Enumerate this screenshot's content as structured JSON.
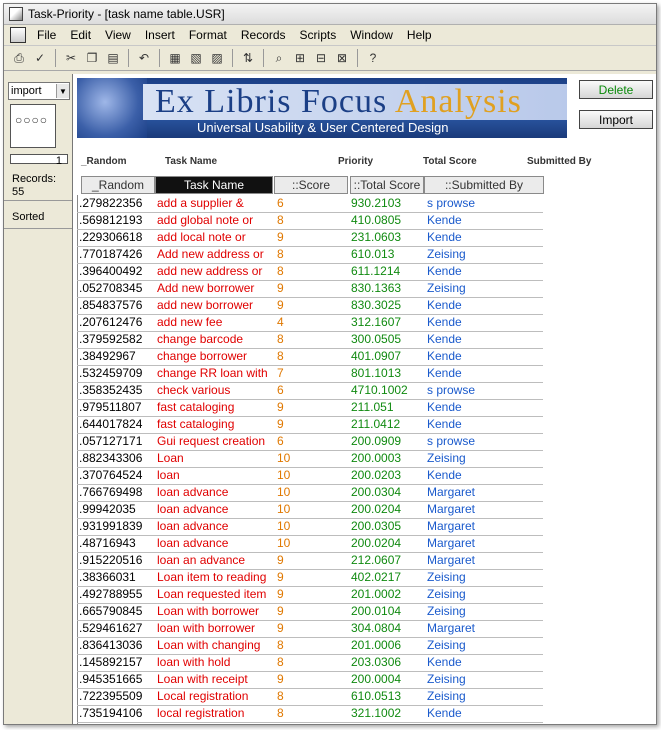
{
  "window": {
    "title": "Task-Priority - [task name table.USR]"
  },
  "menu": [
    "File",
    "Edit",
    "View",
    "Insert",
    "Format",
    "Records",
    "Scripts",
    "Window",
    "Help"
  ],
  "sidebar": {
    "layout_value": "import",
    "record_number": "1",
    "records_label": "Records:",
    "records_count": "55",
    "sort_status": "Sorted"
  },
  "banner": {
    "ex": "Ex",
    "libris": "Libris",
    "focus": "Focus",
    "analysis": "Analysis",
    "subtitle": "Universal Usability & User Centered Design"
  },
  "buttons": {
    "delete": "Delete",
    "import": "Import"
  },
  "header_labels": {
    "random": "_Random",
    "task": "Task Name",
    "priority": "Priority",
    "total": "Total Score",
    "submitted": "Submitted By"
  },
  "columns": {
    "random": "_Random",
    "task": "Task Name",
    "score": "::Score",
    "total": "::Total Score",
    "submitted": "::Submitted By"
  },
  "rows": [
    {
      "random": ".279822356",
      "task": "add a supplier &",
      "score": "6",
      "total": "930.2103",
      "submitted": "s prowse"
    },
    {
      "random": ".569812193",
      "task": "add global note or",
      "score": "8",
      "total": "410.0805",
      "submitted": "Kende"
    },
    {
      "random": ".229306618",
      "task": "add local note or",
      "score": "9",
      "total": "231.0603",
      "submitted": "Kende"
    },
    {
      "random": ".770187426",
      "task": "Add new address or",
      "score": "8",
      "total": "610.013",
      "submitted": "Zeising"
    },
    {
      "random": ".396400492",
      "task": "add new address or",
      "score": "8",
      "total": "611.1214",
      "submitted": "Kende"
    },
    {
      "random": ".052708345",
      "task": "Add new borrower",
      "score": "9",
      "total": "830.1363",
      "submitted": "Zeising"
    },
    {
      "random": ".854837576",
      "task": "add new borrower",
      "score": "9",
      "total": "830.3025",
      "submitted": "Kende"
    },
    {
      "random": ".207612476",
      "task": "add new fee",
      "score": "4",
      "total": "312.1607",
      "submitted": "Kende"
    },
    {
      "random": ".379592582",
      "task": "change barcode",
      "score": "8",
      "total": "300.0505",
      "submitted": "Kende"
    },
    {
      "random": ".38492967",
      "task": "change borrower",
      "score": "8",
      "total": "401.0907",
      "submitted": "Kende"
    },
    {
      "random": ".532459709",
      "task": "change RR loan with",
      "score": "7",
      "total": "801.1013",
      "submitted": "Kende"
    },
    {
      "random": ".358352435",
      "task": "check various",
      "score": "6",
      "total": "4710.1002",
      "submitted": "s prowse"
    },
    {
      "random": ".979511807",
      "task": "fast cataloging",
      "score": "9",
      "total": "211.051",
      "submitted": "Kende"
    },
    {
      "random": ".644017824",
      "task": "fast cataloging",
      "score": "9",
      "total": "211.0412",
      "submitted": "Kende"
    },
    {
      "random": ".057127171",
      "task": "Gui request creation",
      "score": "6",
      "total": "200.0909",
      "submitted": "s prowse"
    },
    {
      "random": ".882343306",
      "task": "Loan",
      "score": "10",
      "total": "200.0003",
      "submitted": "Zeising"
    },
    {
      "random": ".370764524",
      "task": "loan",
      "score": "10",
      "total": "200.0203",
      "submitted": "Kende"
    },
    {
      "random": ".766769498",
      "task": "loan advance",
      "score": "10",
      "total": "200.0304",
      "submitted": "Margaret"
    },
    {
      "random": ".99942035",
      "task": "loan advance",
      "score": "10",
      "total": "200.0204",
      "submitted": "Margaret"
    },
    {
      "random": ".931991839",
      "task": "loan advance",
      "score": "10",
      "total": "200.0305",
      "submitted": "Margaret"
    },
    {
      "random": ".48716943",
      "task": "loan advance",
      "score": "10",
      "total": "200.0204",
      "submitted": "Margaret"
    },
    {
      "random": ".915220516",
      "task": "loan an advance",
      "score": "9",
      "total": "212.0607",
      "submitted": "Margaret"
    },
    {
      "random": ".38366031",
      "task": "Loan item to reading",
      "score": "9",
      "total": "402.0217",
      "submitted": "Zeising"
    },
    {
      "random": ".492788955",
      "task": "Loan requested item",
      "score": "9",
      "total": "201.0002",
      "submitted": "Zeising"
    },
    {
      "random": ".665790845",
      "task": "Loan with borrower",
      "score": "9",
      "total": "200.0104",
      "submitted": "Zeising"
    },
    {
      "random": ".529461627",
      "task": "loan with borrower",
      "score": "9",
      "total": "304.0804",
      "submitted": "Margaret"
    },
    {
      "random": ".836413036",
      "task": "Loan with changing",
      "score": "8",
      "total": "201.0006",
      "submitted": "Zeising"
    },
    {
      "random": ".145892157",
      "task": "loan with hold",
      "score": "8",
      "total": "203.0306",
      "submitted": "Kende"
    },
    {
      "random": ".945351665",
      "task": "Loan with receipt",
      "score": "9",
      "total": "200.0004",
      "submitted": "Zeising"
    },
    {
      "random": ".722395509",
      "task": "Local registration",
      "score": "8",
      "total": "610.0513",
      "submitted": "Zeising"
    },
    {
      "random": ".735194106",
      "task": "local registration",
      "score": "8",
      "total": "321.1002",
      "submitted": "Kende"
    }
  ]
}
